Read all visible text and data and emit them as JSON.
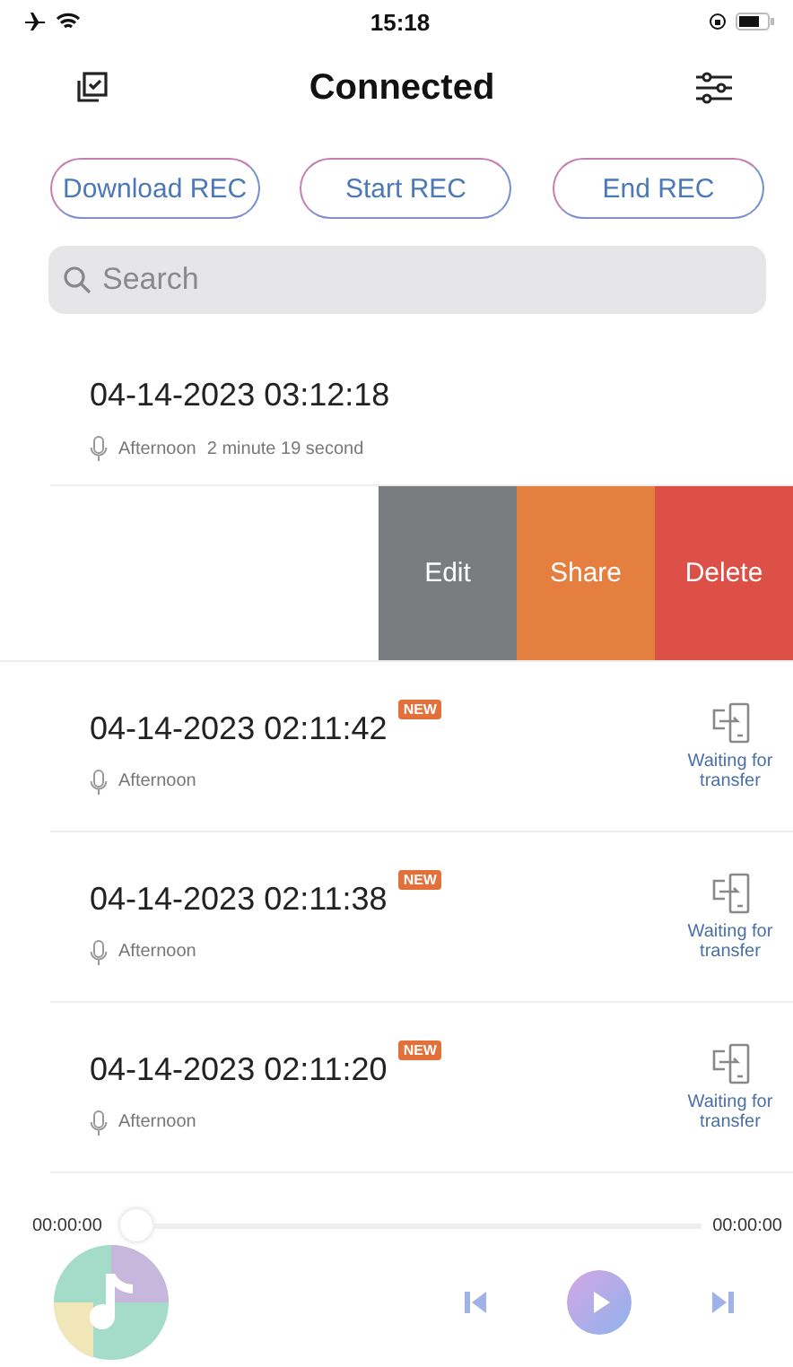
{
  "status_bar": {
    "time": "15:18"
  },
  "nav": {
    "title": "Connected"
  },
  "actions": [
    {
      "label": "Download REC"
    },
    {
      "label": "Start REC"
    },
    {
      "label": "End REC"
    }
  ],
  "search": {
    "placeholder": "Search"
  },
  "recordings": [
    {
      "kind": "record",
      "title": "04-14-2023 03:12:18",
      "new": false,
      "tag": "Afternoon",
      "duration": "2 minute 19 second"
    },
    {
      "kind": "swiped",
      "buttons": [
        {
          "label": "Edit",
          "color": "#7b7c80"
        },
        {
          "label": "Share",
          "color": "#e57f3f"
        },
        {
          "label": "Delete",
          "color": "#dc5047"
        }
      ]
    },
    {
      "kind": "record",
      "title": "04-14-2023 02:11:42",
      "new": true,
      "badge": "NEW",
      "tag": "Afternoon",
      "transfer": "Waiting for transfer"
    },
    {
      "kind": "record",
      "title": "04-14-2023 02:11:38",
      "new": true,
      "badge": "NEW",
      "tag": "Afternoon",
      "transfer": "Waiting for transfer"
    },
    {
      "kind": "record",
      "title": "04-14-2023 02:11:20",
      "new": true,
      "badge": "NEW",
      "tag": "Afternoon",
      "transfer": "Waiting for transfer"
    }
  ],
  "player": {
    "elapsed": "00:00:00",
    "total": "00:00:00",
    "level": 0
  }
}
